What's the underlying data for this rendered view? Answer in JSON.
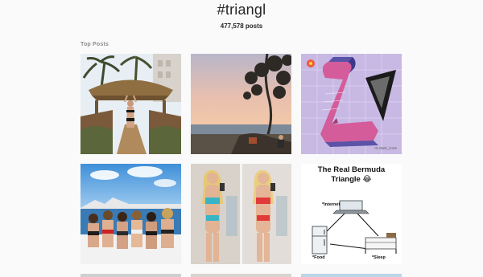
{
  "header": {
    "hashtag": "#triangl",
    "post_count": "477,578 posts"
  },
  "section": {
    "top_posts_label": "Top Posts"
  },
  "tiles": [
    {
      "icon": "tiki-hut-bikini-photo"
    },
    {
      "icon": "sunset-beach-photo"
    },
    {
      "icon": "pink-3d-z-shape-art",
      "watermark": "IG Dark_Core"
    },
    {
      "icon": "group-boat-photo"
    },
    {
      "icon": "mirror-selfie-photo"
    },
    {
      "icon": "meme-triangle",
      "title_line1": "The Real Bermuda",
      "title_line2": "Triangle",
      "emoji": "😂",
      "label_internet": "*Internet",
      "label_food": "*Food",
      "label_sleep": "*Sleep"
    }
  ]
}
